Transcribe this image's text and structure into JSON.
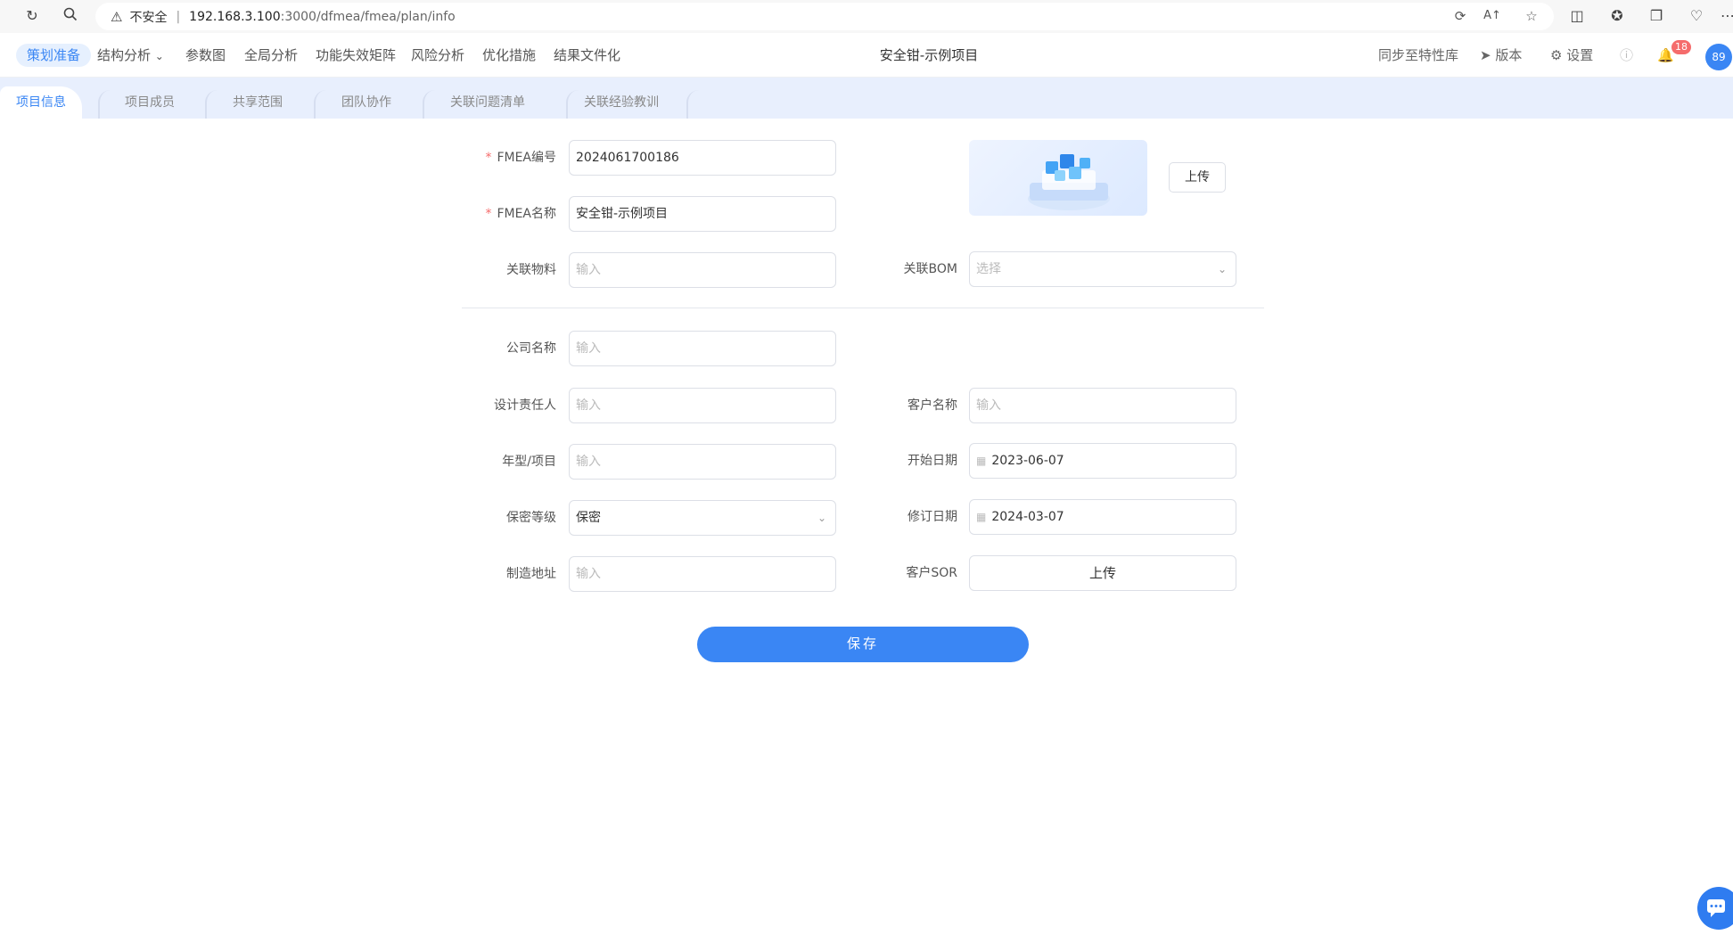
{
  "browser": {
    "security_label": "不安全",
    "url_host": "192.168.3.100",
    "url_path": ":3000/dfmea/fmea/plan/info"
  },
  "header": {
    "nav": [
      "策划准备",
      "结构分析",
      "参数图",
      "全局分析",
      "功能失效矩阵",
      "风险分析",
      "优化措施",
      "结果文件化"
    ],
    "project_title": "安全钳-示例项目",
    "sync_label": "同步至特性库",
    "version_label": "版本",
    "settings_label": "设置",
    "notification_count": "18",
    "avatar_text": "89"
  },
  "tabs": [
    "项目信息",
    "项目成员",
    "共享范围",
    "团队协作",
    "关联问题清单",
    "关联经验教训"
  ],
  "form": {
    "fmea_no_label": "FMEA编号",
    "fmea_no_value": "2024061700186",
    "fmea_name_label": "FMEA名称",
    "fmea_name_value": "安全钳-示例项目",
    "material_label": "关联物料",
    "bom_label": "关联BOM",
    "company_label": "公司名称",
    "designer_label": "设计责任人",
    "customer_label": "客户名称",
    "model_label": "年型/项目",
    "start_date_label": "开始日期",
    "start_date_value": "2023-06-07",
    "secrecy_label": "保密等级",
    "secrecy_value": "保密",
    "revise_date_label": "修订日期",
    "revise_date_value": "2024-03-07",
    "address_label": "制造地址",
    "sor_label": "客户SOR",
    "input_placeholder": "输入",
    "select_placeholder": "选择",
    "upload_label": "上传",
    "sor_upload_label": "上传",
    "save_label": "保存",
    "required_mark": "*"
  },
  "colors": {
    "accent": "#3a86f4",
    "required": "#f56c6c",
    "tab_strip": "#e8effd"
  }
}
